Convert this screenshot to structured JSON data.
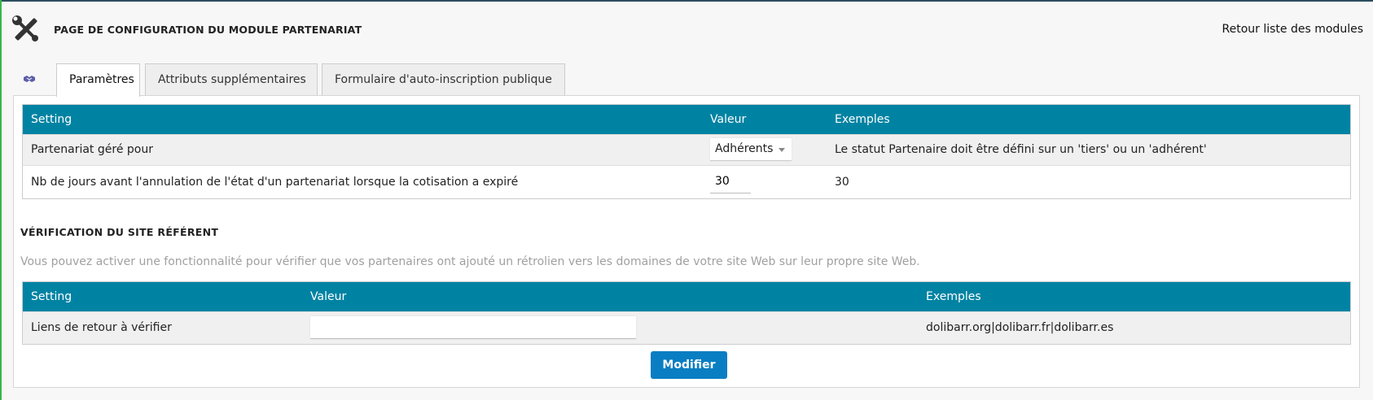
{
  "header": {
    "title": "PAGE DE CONFIGURATION DU MODULE PARTENARIAT",
    "back_link": "Retour liste des modules"
  },
  "tabs": [
    {
      "label": "Paramètres",
      "active": true
    },
    {
      "label": "Attributs supplémentaires",
      "active": false
    },
    {
      "label": "Formulaire d'auto-inscription publique",
      "active": false
    }
  ],
  "settings_table": {
    "headers": [
      "Setting",
      "Valeur",
      "Exemples"
    ],
    "rows": [
      {
        "setting": "Partenariat géré pour",
        "value": "Adhérents",
        "example": "Le statut Partenaire doit être défini sur un 'tiers' ou un 'adhérent'"
      },
      {
        "setting": "Nb de jours avant l'annulation de l'état d'un partenariat lorsque la cotisation a expiré",
        "value": "30",
        "example": "30"
      }
    ]
  },
  "referrer_section": {
    "title": "VÉRIFICATION DU SITE RÉFÉRENT",
    "description": "Vous pouvez activer une fonctionnalité pour vérifier que vos partenaires ont ajouté un rétrolien vers les domaines de votre site Web sur leur propre site Web.",
    "table": {
      "headers": [
        "Setting",
        "Valeur",
        "Exemples"
      ],
      "rows": [
        {
          "setting": "Liens de retour à vérifier",
          "value": "",
          "example": "dolibarr.org|dolibarr.fr|dolibarr.es"
        }
      ]
    }
  },
  "buttons": {
    "modify": "Modifier"
  },
  "colors": {
    "table_header": "#0083a3",
    "button": "#0a7ec2",
    "top_accent": "#2d4e5f",
    "left_accent": "#39b54a",
    "tab_icon": "#5b5fa8"
  },
  "icons": {
    "header": "tools-icon",
    "tab": "handshake-icon"
  }
}
